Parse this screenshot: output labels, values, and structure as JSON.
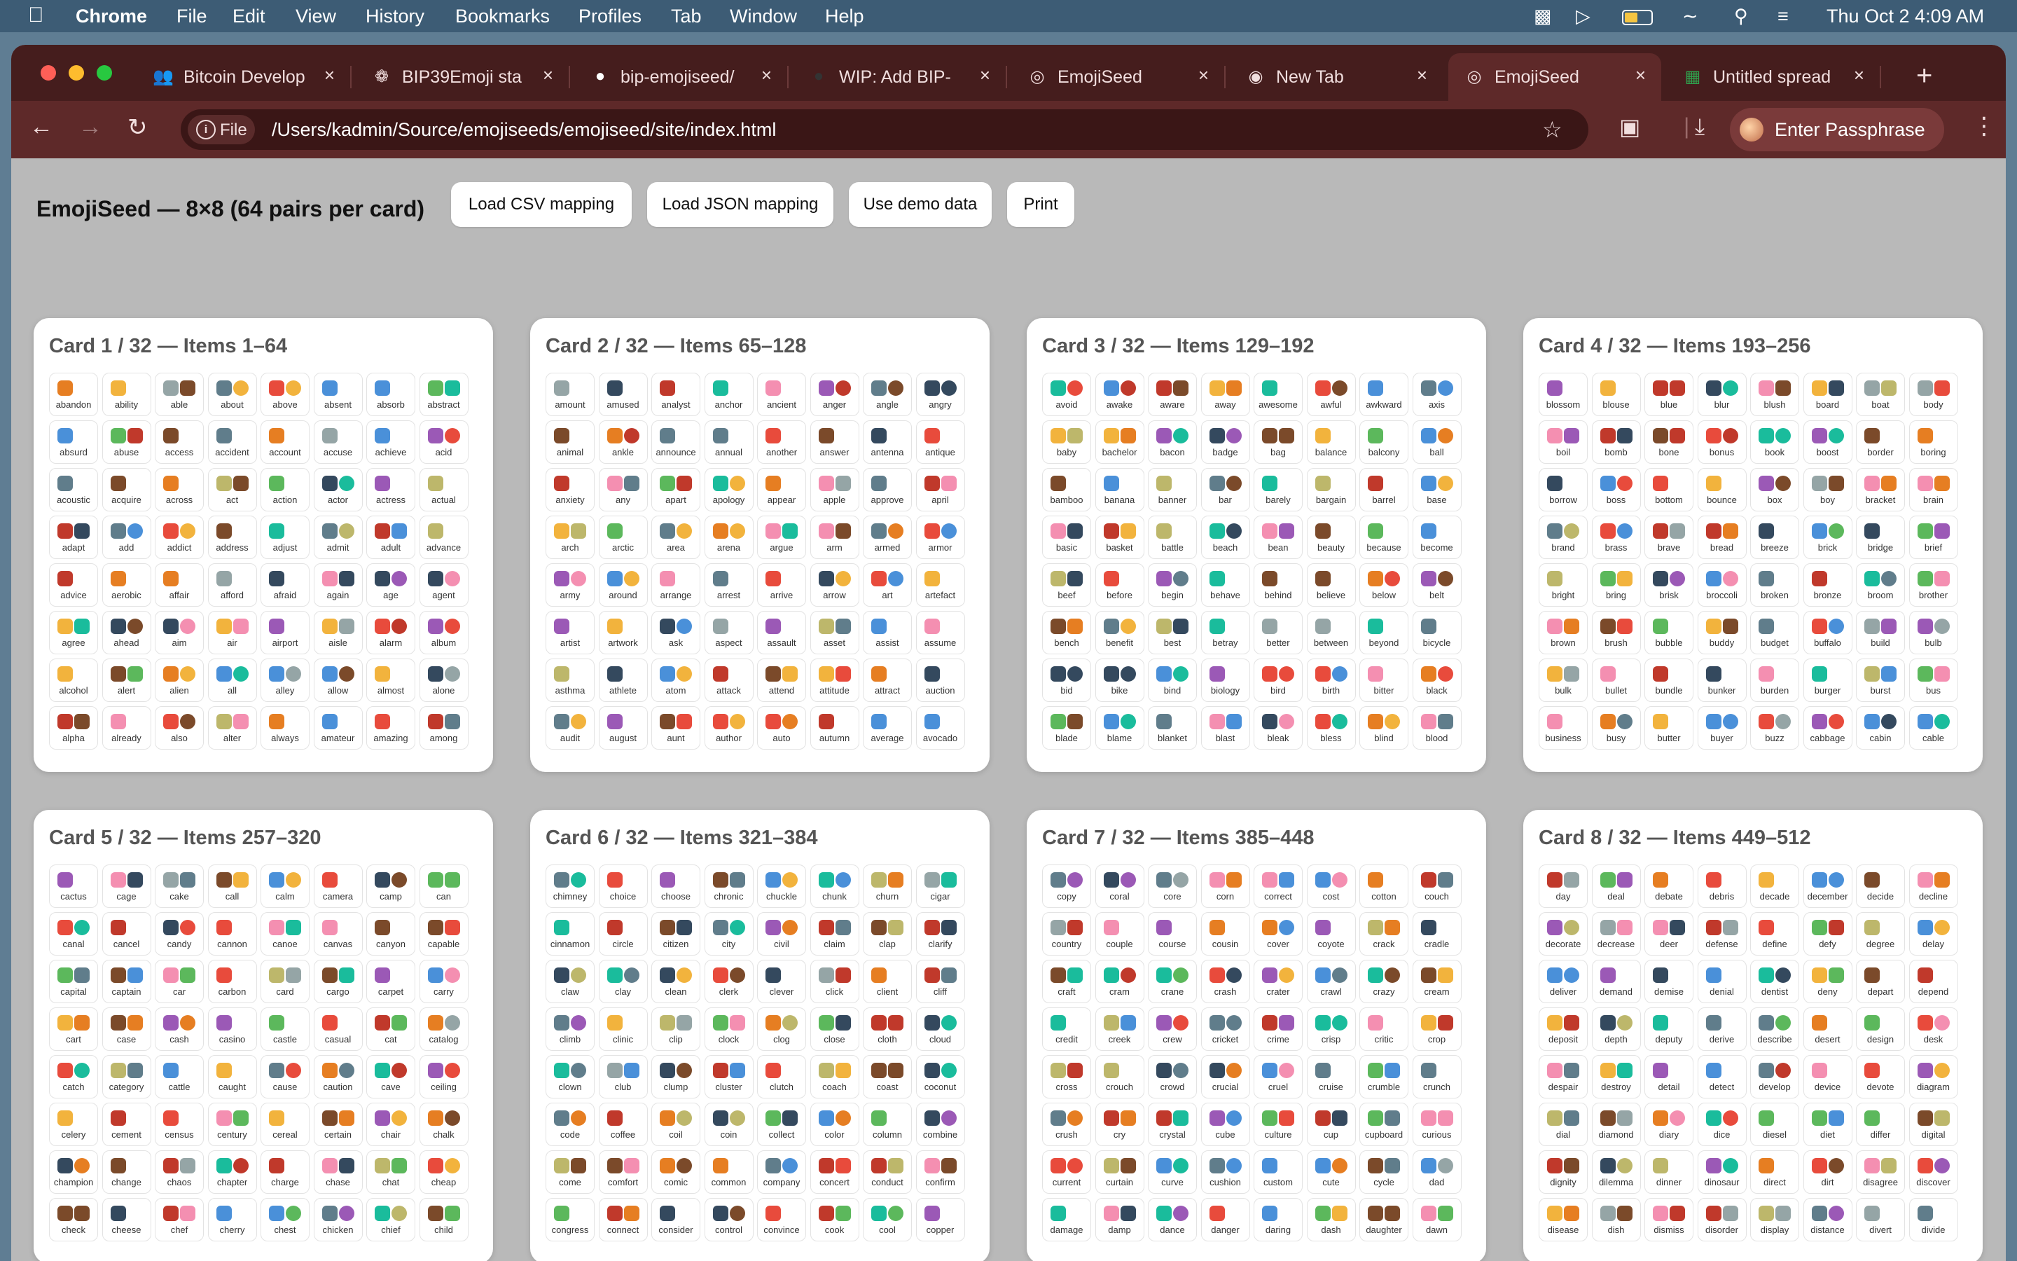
{
  "menubar": {
    "app": "Chrome",
    "items": [
      "File",
      "Edit",
      "View",
      "History",
      "Bookmarks",
      "Profiles",
      "Tab",
      "Window",
      "Help"
    ],
    "clock": "Thu Oct 2  4:09 AM"
  },
  "tabs": [
    {
      "title": "Bitcoin Develop",
      "icon": "people-icon",
      "icon_color": "#6f8fff"
    },
    {
      "title": "BIP39Emoji sta",
      "icon": "openai-icon",
      "icon_color": "#f1dede"
    },
    {
      "title": "bip-emojiseed/",
      "icon": "github-icon",
      "icon_color": "#ffffff"
    },
    {
      "title": "WIP: Add BIP-",
      "icon": "github-icon",
      "icon_color": "#333333"
    },
    {
      "title": "EmojiSeed",
      "icon": "globe-icon",
      "icon_color": "#f1dede"
    },
    {
      "title": "New Tab",
      "icon": "chrome-icon",
      "icon_color": "#f1dede"
    },
    {
      "title": "EmojiSeed",
      "icon": "globe-icon",
      "icon_color": "#f1dede",
      "active": true
    },
    {
      "title": "Untitled spread",
      "icon": "sheets-icon",
      "icon_color": "#2fa14d"
    }
  ],
  "address": {
    "scheme_label": "File",
    "url": "/Users/kadmin/Source/emojiseeds/emojiseed/site/index.html"
  },
  "profile": {
    "label": "Enter Passphrase"
  },
  "page": {
    "title": "EmojiSeed — 8×8 (64 pairs per card)",
    "buttons": [
      "Load CSV mapping",
      "Load JSON mapping",
      "Use demo data",
      "Print"
    ]
  },
  "cards": [
    {
      "title": "Card 1 / 32 — Items 1–64",
      "words": [
        "abandon",
        "ability",
        "able",
        "about",
        "above",
        "absent",
        "absorb",
        "abstract",
        "absurd",
        "abuse",
        "access",
        "accident",
        "account",
        "accuse",
        "achieve",
        "acid",
        "acoustic",
        "acquire",
        "across",
        "act",
        "action",
        "actor",
        "actress",
        "actual",
        "adapt",
        "add",
        "addict",
        "address",
        "adjust",
        "admit",
        "adult",
        "advance",
        "advice",
        "aerobic",
        "affair",
        "afford",
        "afraid",
        "again",
        "age",
        "agent",
        "agree",
        "ahead",
        "aim",
        "air",
        "airport",
        "aisle",
        "alarm",
        "album",
        "alcohol",
        "alert",
        "alien",
        "all",
        "alley",
        "allow",
        "almost",
        "alone",
        "alpha",
        "already",
        "also",
        "alter",
        "always",
        "amateur",
        "amazing",
        "among"
      ]
    },
    {
      "title": "Card 2 / 32 — Items 65–128",
      "words": [
        "amount",
        "amused",
        "analyst",
        "anchor",
        "ancient",
        "anger",
        "angle",
        "angry",
        "animal",
        "ankle",
        "announce",
        "annual",
        "another",
        "answer",
        "antenna",
        "antique",
        "anxiety",
        "any",
        "apart",
        "apology",
        "appear",
        "apple",
        "approve",
        "april",
        "arch",
        "arctic",
        "area",
        "arena",
        "argue",
        "arm",
        "armed",
        "armor",
        "army",
        "around",
        "arrange",
        "arrest",
        "arrive",
        "arrow",
        "art",
        "artefact",
        "artist",
        "artwork",
        "ask",
        "aspect",
        "assault",
        "asset",
        "assist",
        "assume",
        "asthma",
        "athlete",
        "atom",
        "attack",
        "attend",
        "attitude",
        "attract",
        "auction",
        "audit",
        "august",
        "aunt",
        "author",
        "auto",
        "autumn",
        "average",
        "avocado"
      ]
    },
    {
      "title": "Card 3 / 32 — Items 129–192",
      "words": [
        "avoid",
        "awake",
        "aware",
        "away",
        "awesome",
        "awful",
        "awkward",
        "axis",
        "baby",
        "bachelor",
        "bacon",
        "badge",
        "bag",
        "balance",
        "balcony",
        "ball",
        "bamboo",
        "banana",
        "banner",
        "bar",
        "barely",
        "bargain",
        "barrel",
        "base",
        "basic",
        "basket",
        "battle",
        "beach",
        "bean",
        "beauty",
        "because",
        "become",
        "beef",
        "before",
        "begin",
        "behave",
        "behind",
        "believe",
        "below",
        "belt",
        "bench",
        "benefit",
        "best",
        "betray",
        "better",
        "between",
        "beyond",
        "bicycle",
        "bid",
        "bike",
        "bind",
        "biology",
        "bird",
        "birth",
        "bitter",
        "black",
        "blade",
        "blame",
        "blanket",
        "blast",
        "bleak",
        "bless",
        "blind",
        "blood"
      ]
    },
    {
      "title": "Card 4 / 32 — Items 193–256",
      "words": [
        "blossom",
        "blouse",
        "blue",
        "blur",
        "blush",
        "board",
        "boat",
        "body",
        "boil",
        "bomb",
        "bone",
        "bonus",
        "book",
        "boost",
        "border",
        "boring",
        "borrow",
        "boss",
        "bottom",
        "bounce",
        "box",
        "boy",
        "bracket",
        "brain",
        "brand",
        "brass",
        "brave",
        "bread",
        "breeze",
        "brick",
        "bridge",
        "brief",
        "bright",
        "bring",
        "brisk",
        "broccoli",
        "broken",
        "bronze",
        "broom",
        "brother",
        "brown",
        "brush",
        "bubble",
        "buddy",
        "budget",
        "buffalo",
        "build",
        "bulb",
        "bulk",
        "bullet",
        "bundle",
        "bunker",
        "burden",
        "burger",
        "burst",
        "bus",
        "business",
        "busy",
        "butter",
        "buyer",
        "buzz",
        "cabbage",
        "cabin",
        "cable"
      ]
    },
    {
      "title": "Card 5 / 32 — Items 257–320",
      "words": [
        "cactus",
        "cage",
        "cake",
        "call",
        "calm",
        "camera",
        "camp",
        "can",
        "canal",
        "cancel",
        "candy",
        "cannon",
        "canoe",
        "canvas",
        "canyon",
        "capable",
        "capital",
        "captain",
        "car",
        "carbon",
        "card",
        "cargo",
        "carpet",
        "carry",
        "cart",
        "case",
        "cash",
        "casino",
        "castle",
        "casual",
        "cat",
        "catalog",
        "catch",
        "category",
        "cattle",
        "caught",
        "cause",
        "caution",
        "cave",
        "ceiling",
        "celery",
        "cement",
        "census",
        "century",
        "cereal",
        "certain",
        "chair",
        "chalk",
        "champion",
        "change",
        "chaos",
        "chapter",
        "charge",
        "chase",
        "chat",
        "cheap",
        "check",
        "cheese",
        "chef",
        "cherry",
        "chest",
        "chicken",
        "chief",
        "child"
      ]
    },
    {
      "title": "Card 6 / 32 — Items 321–384",
      "words": [
        "chimney",
        "choice",
        "choose",
        "chronic",
        "chuckle",
        "chunk",
        "churn",
        "cigar",
        "cinnamon",
        "circle",
        "citizen",
        "city",
        "civil",
        "claim",
        "clap",
        "clarify",
        "claw",
        "clay",
        "clean",
        "clerk",
        "clever",
        "click",
        "client",
        "cliff",
        "climb",
        "clinic",
        "clip",
        "clock",
        "clog",
        "close",
        "cloth",
        "cloud",
        "clown",
        "club",
        "clump",
        "cluster",
        "clutch",
        "coach",
        "coast",
        "coconut",
        "code",
        "coffee",
        "coil",
        "coin",
        "collect",
        "color",
        "column",
        "combine",
        "come",
        "comfort",
        "comic",
        "common",
        "company",
        "concert",
        "conduct",
        "confirm",
        "congress",
        "connect",
        "consider",
        "control",
        "convince",
        "cook",
        "cool",
        "copper"
      ]
    },
    {
      "title": "Card 7 / 32 — Items 385–448",
      "words": [
        "copy",
        "coral",
        "core",
        "corn",
        "correct",
        "cost",
        "cotton",
        "couch",
        "country",
        "couple",
        "course",
        "cousin",
        "cover",
        "coyote",
        "crack",
        "cradle",
        "craft",
        "cram",
        "crane",
        "crash",
        "crater",
        "crawl",
        "crazy",
        "cream",
        "credit",
        "creek",
        "crew",
        "cricket",
        "crime",
        "crisp",
        "critic",
        "crop",
        "cross",
        "crouch",
        "crowd",
        "crucial",
        "cruel",
        "cruise",
        "crumble",
        "crunch",
        "crush",
        "cry",
        "crystal",
        "cube",
        "culture",
        "cup",
        "cupboard",
        "curious",
        "current",
        "curtain",
        "curve",
        "cushion",
        "custom",
        "cute",
        "cycle",
        "dad",
        "damage",
        "damp",
        "dance",
        "danger",
        "daring",
        "dash",
        "daughter",
        "dawn"
      ]
    },
    {
      "title": "Card 8 / 32 — Items 449–512",
      "words": [
        "day",
        "deal",
        "debate",
        "debris",
        "decade",
        "december",
        "decide",
        "decline",
        "decorate",
        "decrease",
        "deer",
        "defense",
        "define",
        "defy",
        "degree",
        "delay",
        "deliver",
        "demand",
        "demise",
        "denial",
        "dentist",
        "deny",
        "depart",
        "depend",
        "deposit",
        "depth",
        "deputy",
        "derive",
        "describe",
        "desert",
        "design",
        "desk",
        "despair",
        "destroy",
        "detail",
        "detect",
        "develop",
        "device",
        "devote",
        "diagram",
        "dial",
        "diamond",
        "diary",
        "dice",
        "diesel",
        "diet",
        "differ",
        "digital",
        "dignity",
        "dilemma",
        "dinner",
        "dinosaur",
        "direct",
        "dirt",
        "disagree",
        "discover",
        "disease",
        "dish",
        "dismiss",
        "disorder",
        "display",
        "distance",
        "divert",
        "divide"
      ]
    }
  ]
}
